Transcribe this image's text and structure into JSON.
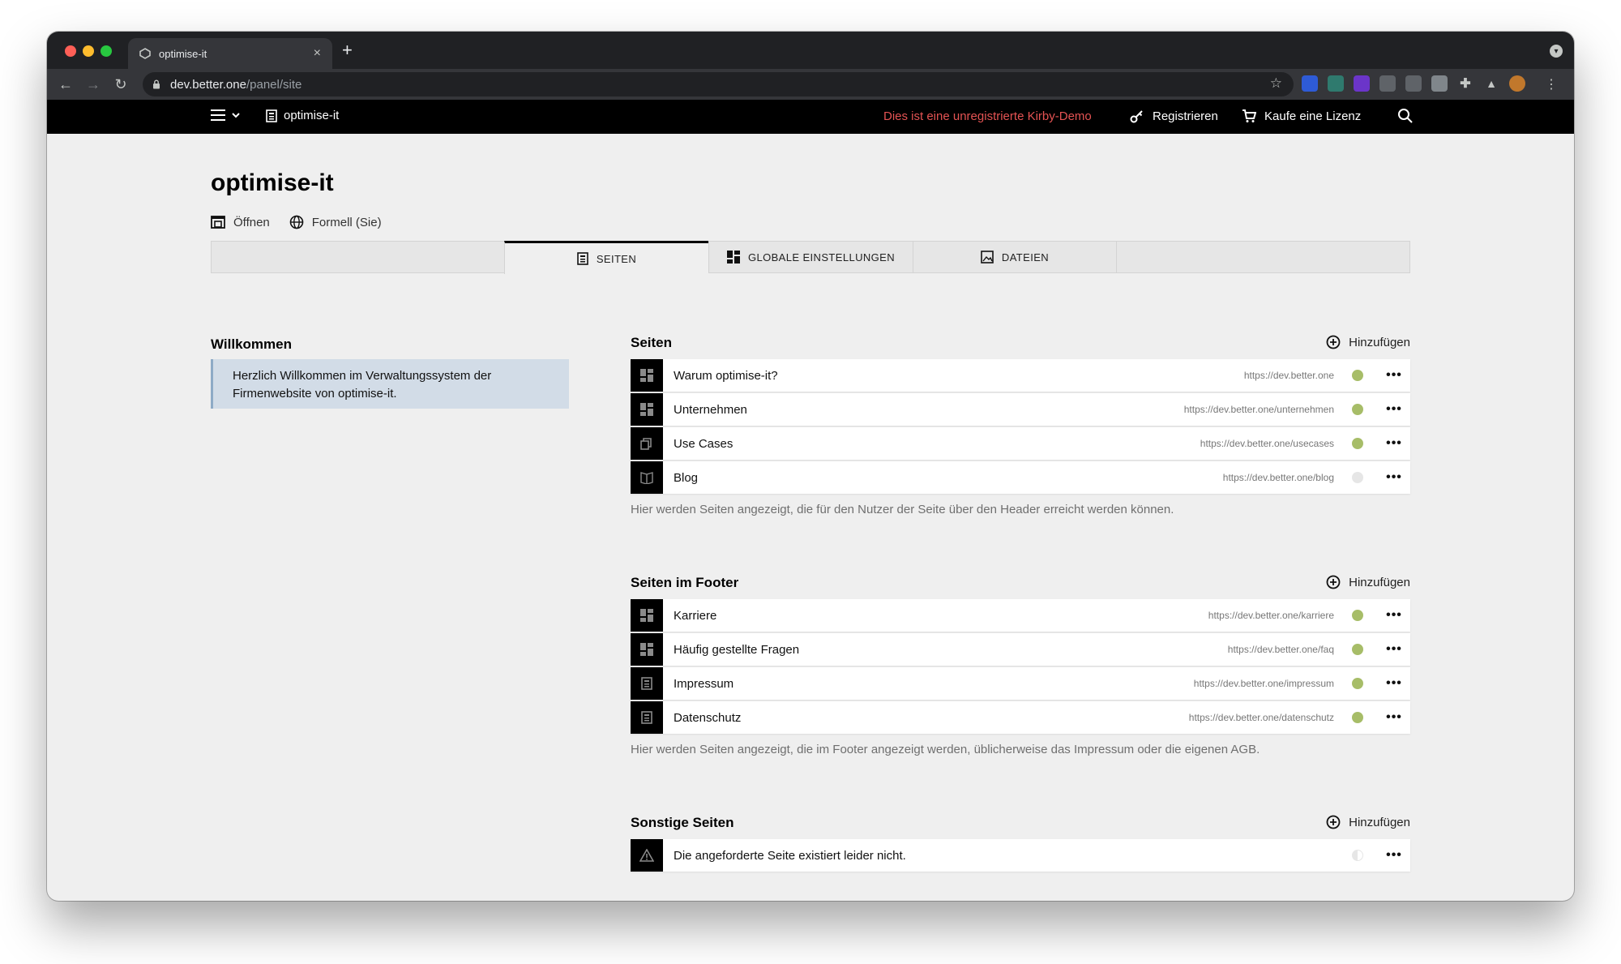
{
  "browser": {
    "tab_title": "optimise-it",
    "tab_close": "×",
    "new_tab": "+",
    "url_host": "dev.better.one",
    "url_path": "/panel/site"
  },
  "kirby_bar": {
    "site_name": "optimise-it",
    "demo_notice": "Dies ist eine unregistrierte Kirby-Demo",
    "register_label": "Registrieren",
    "buy_label": "Kaufe eine Lizenz"
  },
  "page": {
    "title": "optimise-it",
    "open_label": "Öffnen",
    "language_label": "Formell (Sie)"
  },
  "tabs": [
    {
      "label": "SEITEN",
      "icon": "page-icon",
      "active": true
    },
    {
      "label": "GLOBALE EINSTELLUNGEN",
      "icon": "dashboard-icon",
      "active": false
    },
    {
      "label": "DATEIEN",
      "icon": "image-icon",
      "active": false
    }
  ],
  "welcome": {
    "heading": "Willkommen",
    "line1": "Herzlich Willkommen im Verwaltungssystem der",
    "line2": "Firmenwebsite von optimise-it."
  },
  "add_label": "Hinzufügen",
  "colors": {
    "published": "#a7bd68",
    "draft": "#e6e6e6",
    "demo_notice": "#e45353"
  },
  "sections": {
    "main": {
      "heading": "Seiten",
      "help": "Hier werden Seiten angezeigt, die für den Nutzer der Seite über den Header erreicht werden können.",
      "items": [
        {
          "label": "Warum optimise-it?",
          "url": "https://dev.better.one",
          "icon": "dashboard-icon",
          "status": "published"
        },
        {
          "label": "Unternehmen",
          "url": "https://dev.better.one/unternehmen",
          "icon": "dashboard-icon",
          "status": "published"
        },
        {
          "label": "Use Cases",
          "url": "https://dev.better.one/usecases",
          "icon": "pages-icon",
          "status": "published"
        },
        {
          "label": "Blog",
          "url": "https://dev.better.one/blog",
          "icon": "book-icon",
          "status": "draft"
        }
      ]
    },
    "footer": {
      "heading": "Seiten im Footer",
      "help": "Hier werden Seiten angezeigt, die im Footer angezeigt werden, üblicherweise das Impressum oder die eigenen AGB.",
      "items": [
        {
          "label": "Karriere",
          "url": "https://dev.better.one/karriere",
          "icon": "dashboard-icon",
          "status": "published"
        },
        {
          "label": "Häufig gestellte Fragen",
          "url": "https://dev.better.one/faq",
          "icon": "dashboard-icon",
          "status": "published"
        },
        {
          "label": "Impressum",
          "url": "https://dev.better.one/impressum",
          "icon": "page-icon",
          "status": "published"
        },
        {
          "label": "Datenschutz",
          "url": "https://dev.better.one/datenschutz",
          "icon": "page-icon",
          "status": "published"
        }
      ]
    },
    "other": {
      "heading": "Sonstige Seiten",
      "items": [
        {
          "label": "Die angeforderte Seite existiert leider nicht.",
          "url": "",
          "icon": "alert-icon",
          "status": "unlisted"
        }
      ]
    }
  }
}
